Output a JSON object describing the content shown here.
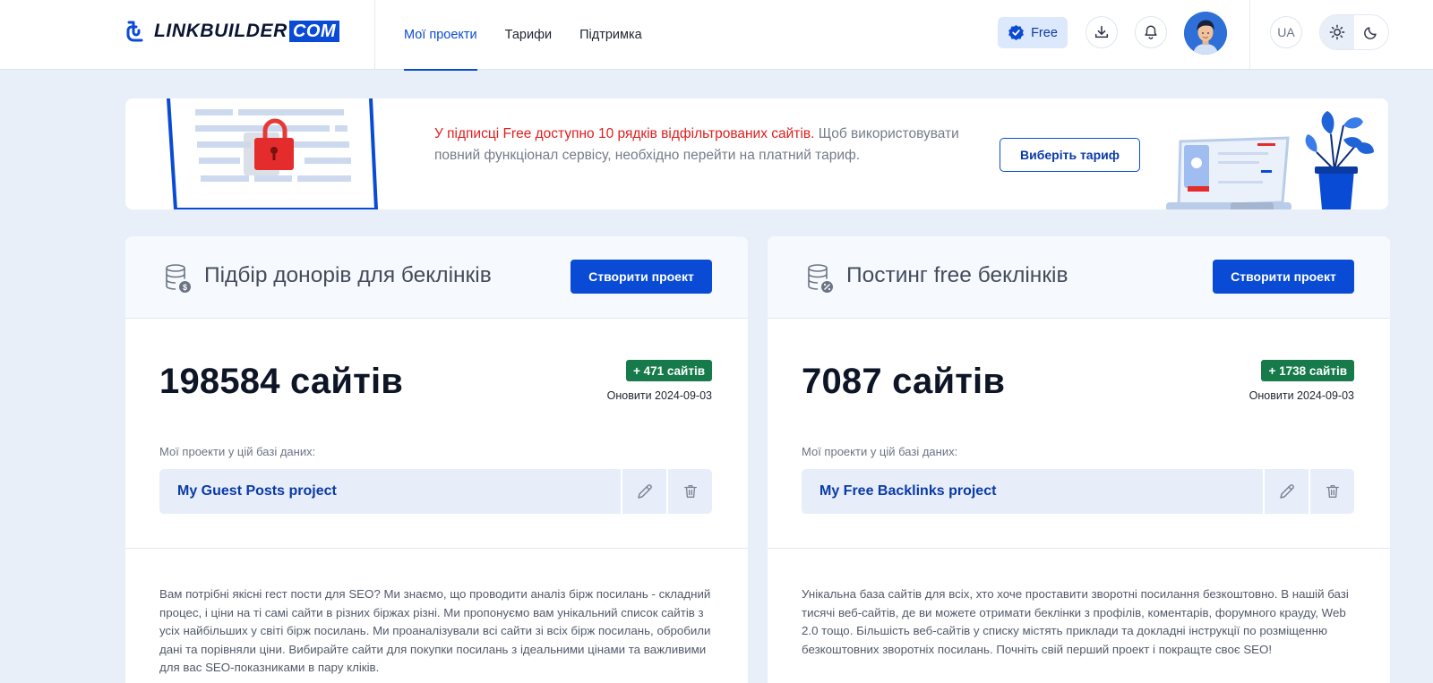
{
  "logo": {
    "text": "LINKBUILDER",
    "suffix": "COM"
  },
  "nav": [
    {
      "label": "Мої проекти",
      "active": true
    },
    {
      "label": "Тарифи",
      "active": false
    },
    {
      "label": "Підтримка",
      "active": false
    }
  ],
  "header": {
    "plan_label": "Free",
    "plan_icon": "verified-badge-icon",
    "language": "UA",
    "theme": "light"
  },
  "banner": {
    "highlight": "У підписці Free доступно 10 рядків відфільтрованих сайтів.",
    "text": " Щоб використовувати повний функціонал сервісу, необхідно перейти на платний тариф.",
    "button": "Виберіть тариф"
  },
  "cards": [
    {
      "title": "Підбір донорів для беклінків",
      "create_button": "Створити проект",
      "count": "198584 сайтів",
      "delta": "+ 471 сайтів",
      "updated": "Оновити 2024-09-03",
      "projects_label": "Мої проекти у цій базі даних:",
      "project_name": "My Guest Posts project",
      "description": "Вам потрібні якісні гест пости для SEO? Ми знаємо, що проводити аналіз бірж посилань - складний процес, і ціни на ті самі сайти в різних біржах різні. Ми пропонуємо вам унікальний список сайтів з усіх найбільших у світі бірж посилань. Ми проаналізували всі сайти зі всіх бірж посилань, обробили дані та порівняли ціни. Вибирайте сайти для покупки посилань з ідеальними цінами та важливими для вас SEO-показниками в пару кліків."
    },
    {
      "title": "Постинг free беклінків",
      "create_button": "Створити проект",
      "count": "7087 сайтів",
      "delta": "+ 1738 сайтів",
      "updated": "Оновити 2024-09-03",
      "projects_label": "Мої проекти у цій базі даних:",
      "project_name": "My Free Backlinks project",
      "description": "Унікальна база сайтів для всіх, хто хоче проставити зворотні посилання безкоштовно. В нашій базі тисячі веб-сайтів, де ви можете отримати беклінки з профілів, коментарів, форумного крауду, Web 2.0 тощо. Більшість веб-сайтів у списку містять приклади та докладні інструкції по розміщенню безкоштовних зворотніх посилань. Почніть свій перший проект і покращте своє SEO!"
    }
  ],
  "colors": {
    "brand": "#0a4bd6",
    "alert": "#e11d1d",
    "success": "#167a4b",
    "page_bg": "#e8eff9"
  }
}
